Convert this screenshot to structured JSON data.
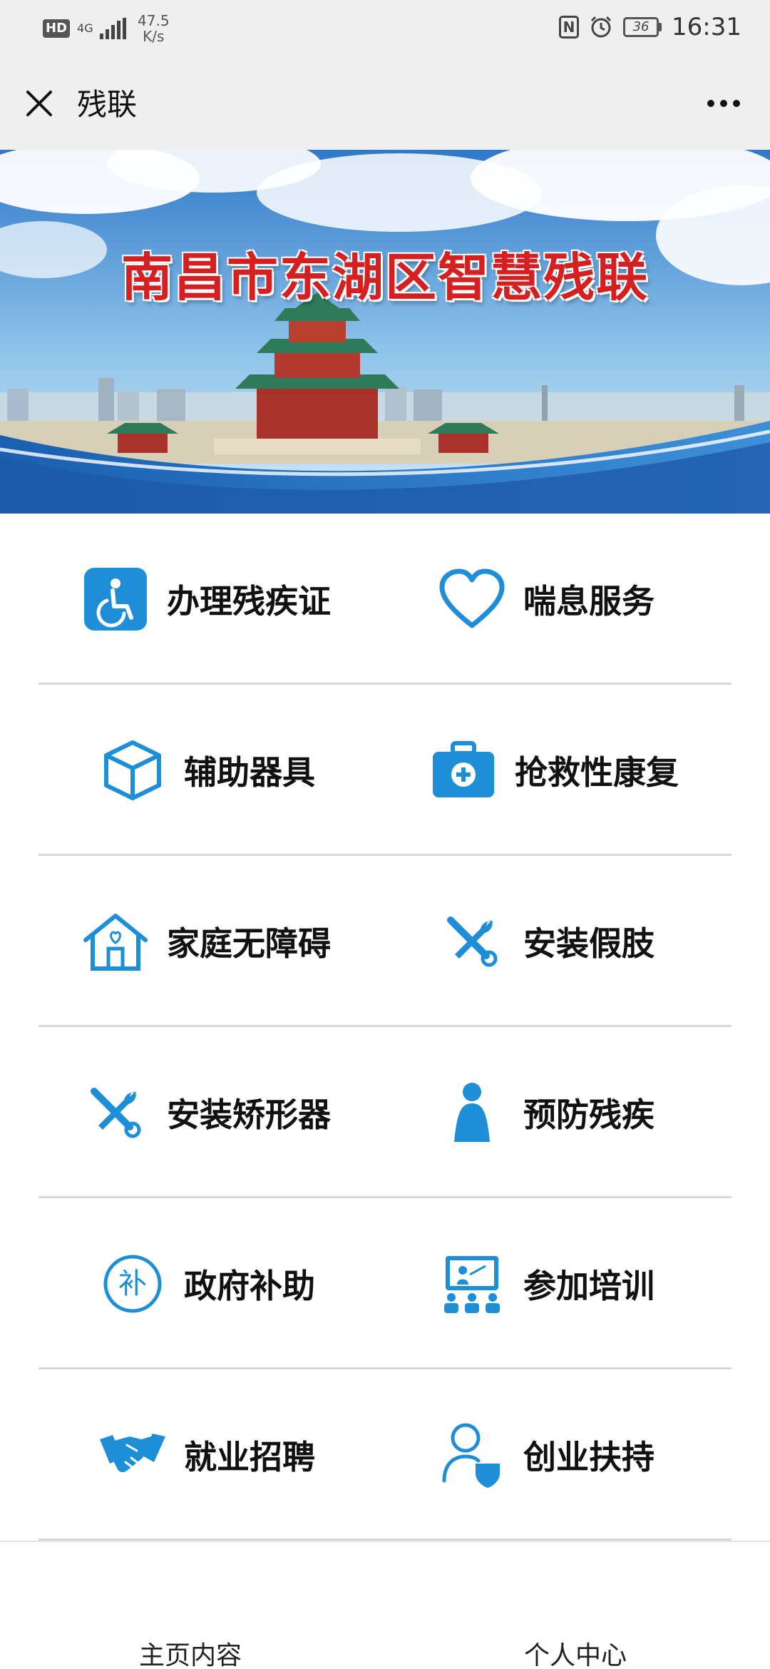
{
  "status_bar": {
    "hd_badge": "HD",
    "network_type": "4G",
    "net_speed_value": "47.5",
    "net_speed_unit": "K/s",
    "nfc_label": "N",
    "battery_level": "36",
    "time": "16:31"
  },
  "nav": {
    "title": "残联",
    "close_icon": "close-icon",
    "more_icon": "more-icon"
  },
  "banner": {
    "title": "南昌市东湖区智慧残联"
  },
  "menu": {
    "accent_color": "#1e8fd6",
    "rows": [
      {
        "left": {
          "label": "办理残疾证",
          "icon": "wheelchair-icon"
        },
        "right": {
          "label": "喘息服务",
          "icon": "heart-icon"
        }
      },
      {
        "left": {
          "label": "辅助器具",
          "icon": "cube-icon"
        },
        "right": {
          "label": "抢救性康复",
          "icon": "medical-kit-icon"
        }
      },
      {
        "left": {
          "label": "家庭无障碍",
          "icon": "home-heart-icon"
        },
        "right": {
          "label": "安装假肢",
          "icon": "tools-icon"
        }
      },
      {
        "left": {
          "label": "安装矫形器",
          "icon": "tools-icon"
        },
        "right": {
          "label": "预防残疾",
          "icon": "person-icon"
        }
      },
      {
        "left": {
          "label": "政府补助",
          "icon": "subsidy-icon"
        },
        "right": {
          "label": "参加培训",
          "icon": "training-icon"
        }
      },
      {
        "left": {
          "label": "就业招聘",
          "icon": "handshake-icon"
        },
        "right": {
          "label": "创业扶持",
          "icon": "user-shield-icon"
        }
      }
    ]
  },
  "subsidy_glyph": "补",
  "tabs": {
    "home": "主页内容",
    "personal": "个人中心"
  }
}
